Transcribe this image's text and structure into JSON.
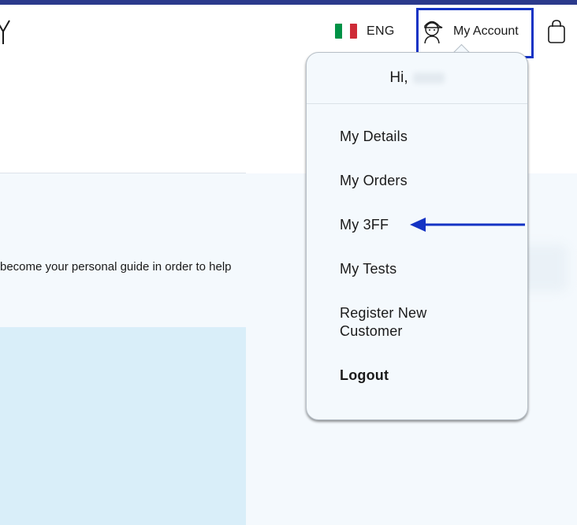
{
  "header": {
    "language_label": "ENG",
    "account_label": "My Account",
    "flag_colors": [
      "#009246",
      "#ffffff",
      "#ce2b37"
    ],
    "accent_color": "#1433c4",
    "icons": [
      "user-icon",
      "shopping-bag-icon",
      "left-arrow-icon"
    ]
  },
  "dropdown": {
    "greeting": "Hi,",
    "items": [
      {
        "label": "My Details"
      },
      {
        "label": "My Orders"
      },
      {
        "label": "My 3FF"
      },
      {
        "label": "My Tests"
      },
      {
        "label": "Register New Customer"
      },
      {
        "label": "Logout"
      }
    ]
  },
  "hero": {
    "text": "become your personal guide in order to help"
  }
}
